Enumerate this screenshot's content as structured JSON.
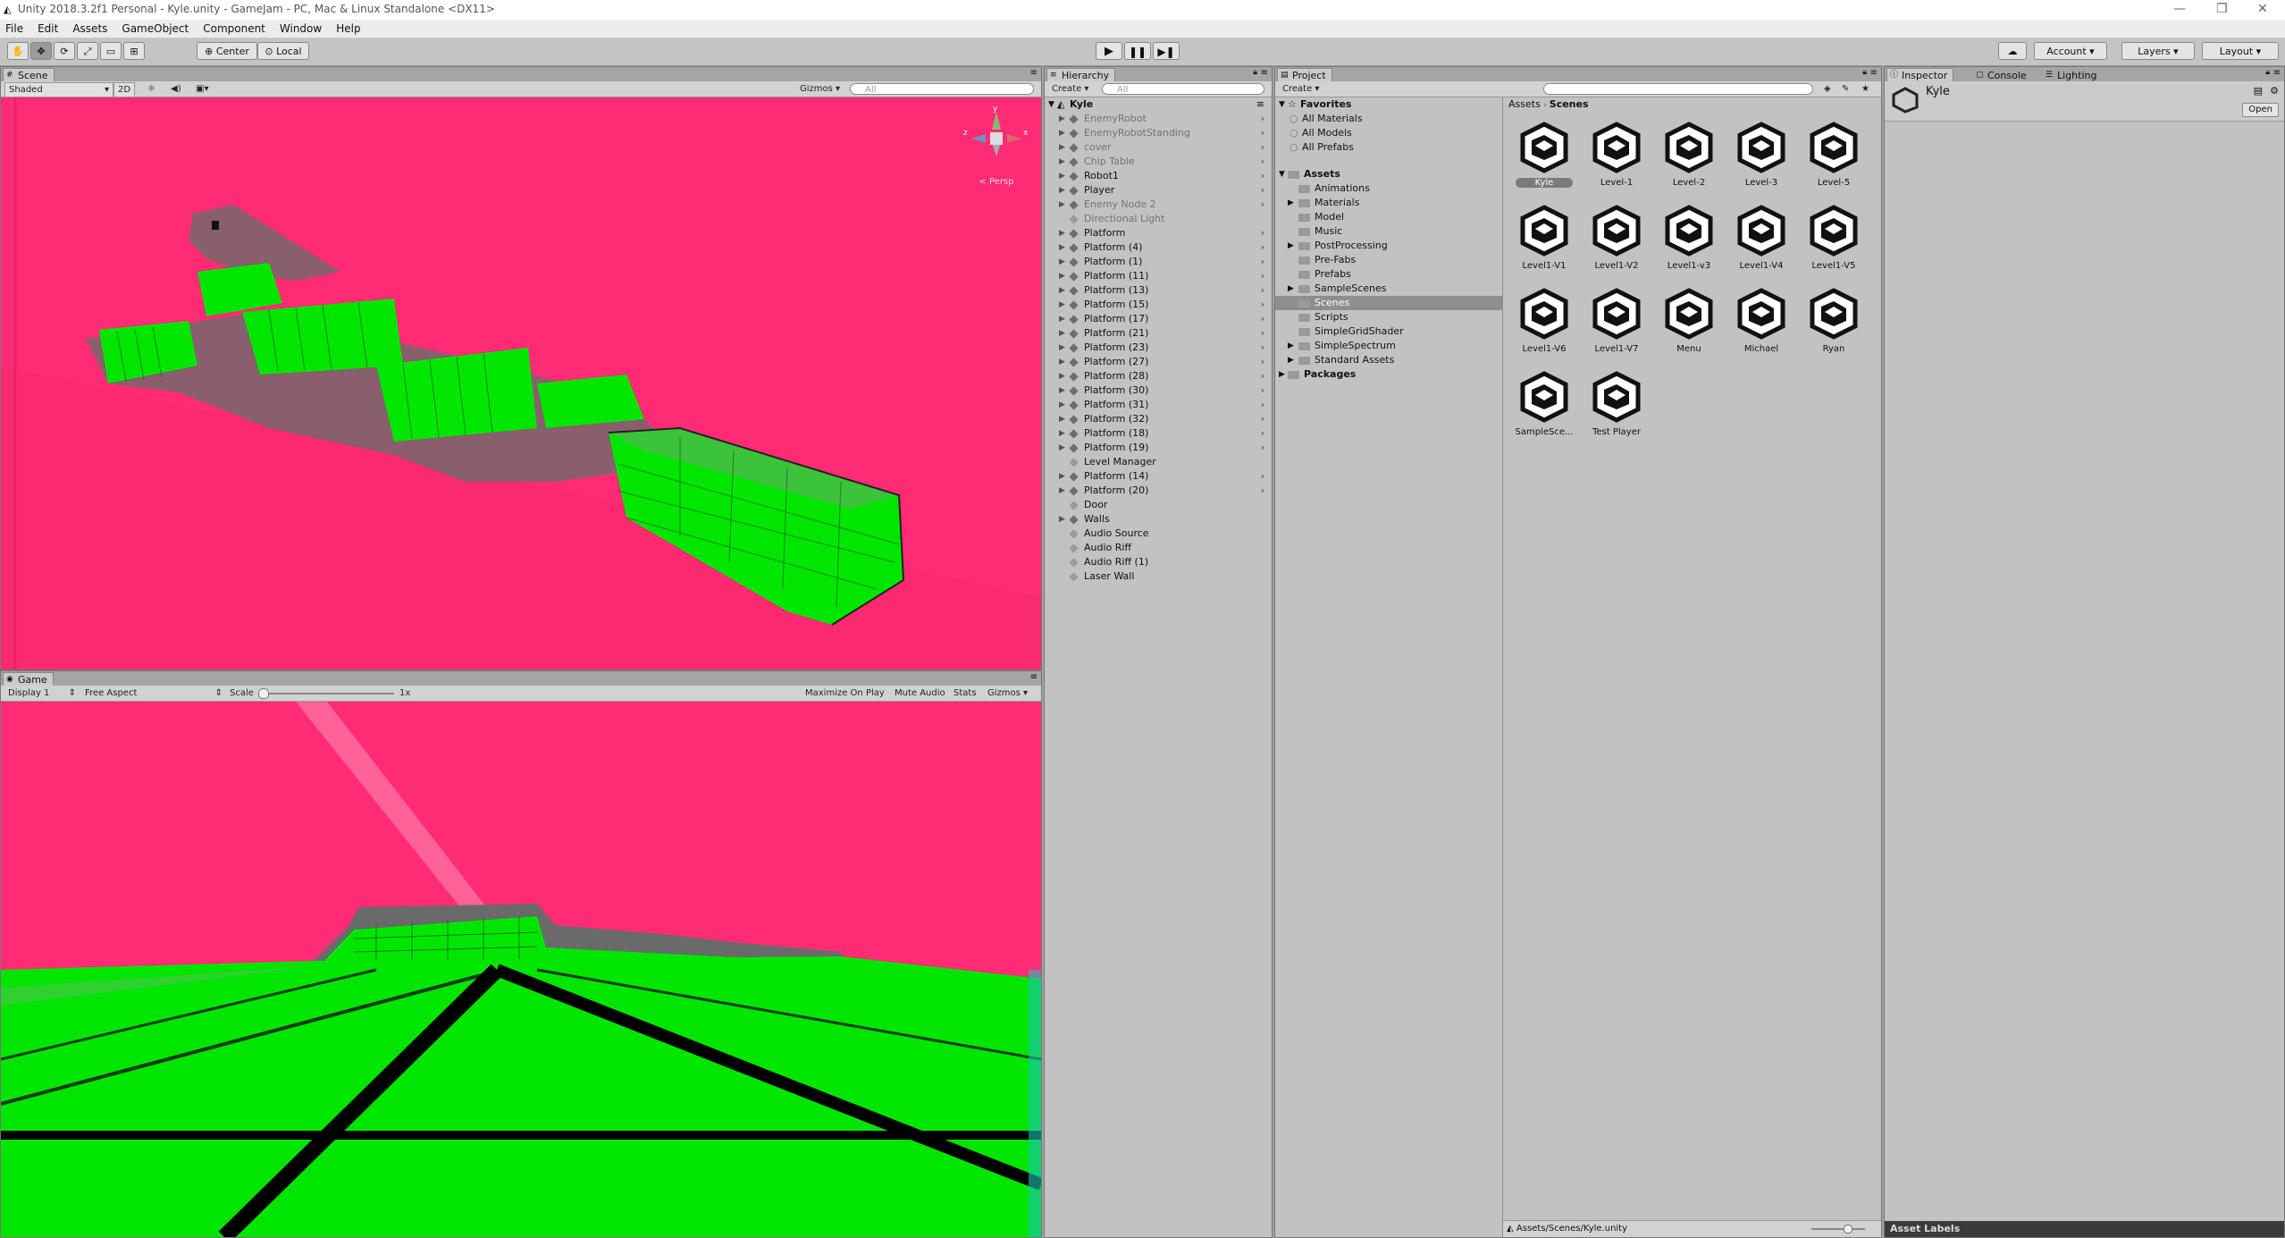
{
  "window": {
    "title": "Unity 2018.3.2f1 Personal - Kyle.unity - GameJam - PC, Mac & Linux Standalone <DX11>"
  },
  "menu": [
    "File",
    "Edit",
    "Assets",
    "GameObject",
    "Component",
    "Window",
    "Help"
  ],
  "toolbar": {
    "tools": [
      "hand-tool",
      "move-tool",
      "rotate-tool",
      "scale-tool",
      "rect-tool",
      "transform-tool"
    ],
    "pivot_label": "Center",
    "space_label": "Local",
    "account_label": "Account",
    "layers_label": "Layers",
    "layout_label": "Layout"
  },
  "scene": {
    "tab": "Scene",
    "shading": "Shaded",
    "mode2d": "2D",
    "gizmos": "Gizmos",
    "search_placeholder": "All",
    "persp": "< Persp",
    "axes": {
      "x": "x",
      "y": "y",
      "z": "z"
    }
  },
  "game": {
    "tab": "Game",
    "display": "Display 1",
    "aspect": "Free Aspect",
    "scale_label": "Scale",
    "scale_value": "1x",
    "maximize": "Maximize On Play",
    "mute": "Mute Audio",
    "stats": "Stats",
    "gizmos": "Gizmos"
  },
  "hierarchy": {
    "tab": "Hierarchy",
    "create": "Create",
    "search_placeholder": "All",
    "scene_name": "Kyle",
    "items": [
      {
        "label": "EnemyRobot",
        "faded": true,
        "expand": true,
        "chev": true
      },
      {
        "label": "EnemyRobotStanding",
        "faded": true,
        "expand": true,
        "chev": true
      },
      {
        "label": "cover",
        "faded": true,
        "expand": true,
        "chev": true
      },
      {
        "label": "Chip Table",
        "faded": true,
        "expand": true,
        "chev": true
      },
      {
        "label": "Robot1",
        "faded": false,
        "expand": true,
        "chev": true
      },
      {
        "label": "Player",
        "faded": false,
        "expand": true,
        "chev": true
      },
      {
        "label": "Enemy Node 2",
        "faded": true,
        "expand": true,
        "chev": true
      },
      {
        "label": "Directional Light",
        "faded": true,
        "expand": false,
        "chev": false
      },
      {
        "label": "Platform",
        "faded": false,
        "expand": true,
        "chev": true
      },
      {
        "label": "Platform (4)",
        "faded": false,
        "expand": true,
        "chev": true
      },
      {
        "label": "Platform (1)",
        "faded": false,
        "expand": true,
        "chev": true
      },
      {
        "label": "Platform (11)",
        "faded": false,
        "expand": true,
        "chev": true
      },
      {
        "label": "Platform (13)",
        "faded": false,
        "expand": true,
        "chev": true
      },
      {
        "label": "Platform (15)",
        "faded": false,
        "expand": true,
        "chev": true
      },
      {
        "label": "Platform (17)",
        "faded": false,
        "expand": true,
        "chev": true
      },
      {
        "label": "Platform (21)",
        "faded": false,
        "expand": true,
        "chev": true
      },
      {
        "label": "Platform (23)",
        "faded": false,
        "expand": true,
        "chev": true
      },
      {
        "label": "Platform (27)",
        "faded": false,
        "expand": true,
        "chev": true
      },
      {
        "label": "Platform (28)",
        "faded": false,
        "expand": true,
        "chev": true
      },
      {
        "label": "Platform (30)",
        "faded": false,
        "expand": true,
        "chev": true
      },
      {
        "label": "Platform (31)",
        "faded": false,
        "expand": true,
        "chev": true
      },
      {
        "label": "Platform (32)",
        "faded": false,
        "expand": true,
        "chev": true
      },
      {
        "label": "Platform (18)",
        "faded": false,
        "expand": true,
        "chev": true
      },
      {
        "label": "Platform (19)",
        "faded": false,
        "expand": true,
        "chev": true
      },
      {
        "label": "Level Manager",
        "faded": false,
        "expand": false,
        "chev": false
      },
      {
        "label": "Platform (14)",
        "faded": false,
        "expand": true,
        "chev": true
      },
      {
        "label": "Platform (20)",
        "faded": false,
        "expand": true,
        "chev": true
      },
      {
        "label": "Door",
        "faded": false,
        "expand": false,
        "chev": false
      },
      {
        "label": "Walls",
        "faded": false,
        "expand": true,
        "chev": false
      },
      {
        "label": "Audio Source",
        "faded": false,
        "expand": false,
        "chev": false
      },
      {
        "label": "Audio Riff",
        "faded": false,
        "expand": false,
        "chev": false
      },
      {
        "label": "Audio Riff (1)",
        "faded": false,
        "expand": false,
        "chev": false
      },
      {
        "label": "Laser Wall",
        "faded": false,
        "expand": false,
        "chev": false
      }
    ]
  },
  "project": {
    "tab": "Project",
    "create": "Create",
    "favorites_label": "Favorites",
    "favorites": [
      "All Materials",
      "All Models",
      "All Prefabs"
    ],
    "assets_label": "Assets",
    "folders": [
      {
        "label": "Animations",
        "expand": false
      },
      {
        "label": "Materials",
        "expand": true
      },
      {
        "label": "Model",
        "expand": false
      },
      {
        "label": "Music",
        "expand": false
      },
      {
        "label": "PostProcessing",
        "expand": true
      },
      {
        "label": "Pre-Fabs",
        "expand": false
      },
      {
        "label": "Prefabs",
        "expand": false
      },
      {
        "label": "SampleScenes",
        "expand": true
      },
      {
        "label": "Scenes",
        "expand": false,
        "selected": true
      },
      {
        "label": "Scripts",
        "expand": false
      },
      {
        "label": "SimpleGridShader",
        "expand": false
      },
      {
        "label": "SimpleSpectrum",
        "expand": true
      },
      {
        "label": "Standard Assets",
        "expand": true
      }
    ],
    "packages_label": "Packages",
    "breadcrumb": [
      "Assets",
      "Scenes"
    ],
    "assets": [
      {
        "name": "Kyle",
        "selected": true
      },
      {
        "name": "Level-1"
      },
      {
        "name": "Level-2"
      },
      {
        "name": "Level-3"
      },
      {
        "name": "Level-5"
      },
      {
        "name": "Level1-V1"
      },
      {
        "name": "Level1-V2"
      },
      {
        "name": "Level1-v3"
      },
      {
        "name": "Level1-V4"
      },
      {
        "name": "Level1-V5"
      },
      {
        "name": "Level1-V6"
      },
      {
        "name": "Level1-V7"
      },
      {
        "name": "Menu"
      },
      {
        "name": "Michael"
      },
      {
        "name": "Ryan"
      },
      {
        "name": "SampleSce..."
      },
      {
        "name": "Test Player"
      }
    ],
    "status_path": "Assets/Scenes/Kyle.unity"
  },
  "inspector": {
    "tabs": [
      "Inspector",
      "Console",
      "Lighting"
    ],
    "object_name": "Kyle",
    "open_button": "Open",
    "asset_labels": "Asset Labels"
  },
  "colors": {
    "sky": "#ff2b74",
    "platform_green": "#00e600",
    "panel_gray": "#c2c2c2"
  }
}
